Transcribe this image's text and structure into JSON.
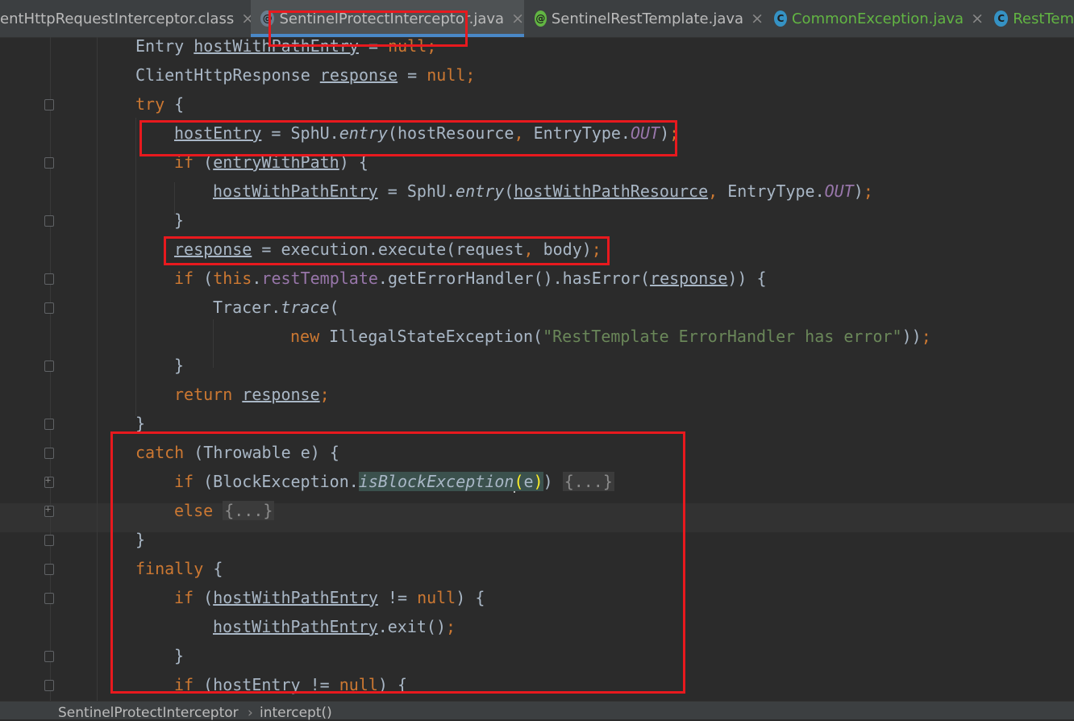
{
  "tabs": [
    {
      "label": "entHttpRequestInterceptor.class",
      "icon": "",
      "active": false
    },
    {
      "label": "SentinelProtectInterceptor.java",
      "icon": "annotation-class-icon",
      "active": true
    },
    {
      "label": "SentinelRestTemplate.java",
      "icon": "annotation-class-icon",
      "active": false
    },
    {
      "label": "CommonException.java",
      "icon": "class-icon",
      "active": false
    },
    {
      "label": "RestTem",
      "icon": "class-icon",
      "active": false
    }
  ],
  "close_glyph": "×",
  "icons": {
    "class": "C",
    "annotation": "@"
  },
  "code": {
    "l1": {
      "a": "Entry ",
      "b": "hostWithPathEntry",
      "c": " = ",
      "d": "null",
      "e": ";"
    },
    "l2": {
      "a": "ClientHttpResponse ",
      "b": "response",
      "c": " = ",
      "d": "null",
      "e": ";"
    },
    "l3": {
      "a": "try",
      "b": " {"
    },
    "l4": {
      "a": "hostEntry",
      "b": " = SphU.",
      "c": "entry",
      "d": "(hostResource",
      "e": ", ",
      "f": "EntryType.",
      "g": "OUT",
      "h": ")",
      "i": ";"
    },
    "l5": {
      "a": "if",
      "b": " (",
      "c": "entryWithPath",
      "d": ") {"
    },
    "l6": {
      "a": "hostWithPathEntry",
      "b": " = SphU.",
      "c": "entry",
      "d": "(",
      "e": "hostWithPathResource",
      "f": ", ",
      "g": "EntryType.",
      "h": "OUT",
      "i": ")",
      "j": ";"
    },
    "l7": {
      "a": "}"
    },
    "l8": {
      "a": "response",
      "b": " = execution.execute(request",
      "c": ", ",
      "d": "body)",
      "e": ";"
    },
    "l9": {
      "a": "if",
      "b": " (",
      "c": "this",
      "d": ".",
      "e": "restTemplate",
      "f": ".getErrorHandler().hasError(",
      "g": "response",
      "h": ")) {"
    },
    "l10": {
      "a": "Tracer.",
      "b": "trace",
      "c": "("
    },
    "l11": {
      "a": "new ",
      "b": "IllegalStateException(",
      "c": "\"RestTemplate ErrorHandler has error\"",
      "d": "))",
      "e": ";"
    },
    "l12": {
      "a": "}"
    },
    "l13": {
      "a": "return ",
      "b": "response",
      "c": ";"
    },
    "l14": {
      "a": "}"
    },
    "l15": {
      "a": "catch",
      "b": " (Throwable e) {"
    },
    "l16": {
      "a": "if",
      "b": " (BlockException.",
      "c": "isBlockException",
      "d": "(",
      "e": "e",
      "f": ")",
      "g": ") ",
      "h": "{...}"
    },
    "l17": {
      "a": "else ",
      "b": "{...}"
    },
    "l18": {
      "a": "}"
    },
    "l19": {
      "a": "finally",
      "b": " {"
    },
    "l20": {
      "a": "if",
      "b": " (",
      "c": "hostWithPathEntry",
      "d": " != ",
      "e": "null",
      "f": ") {"
    },
    "l21": {
      "a": "hostWithPathEntry",
      "b": ".exit()",
      "c": ";"
    },
    "l22": {
      "a": "}"
    },
    "l23": {
      "a": "if",
      "b": " (hostEntry != ",
      "c": "null",
      "d": ") {"
    }
  },
  "breadcrumb": {
    "class_name": "SentinelProtectInterceptor",
    "separator": "›",
    "method_name": "intercept()"
  },
  "colors": {
    "annotation_box": "#e8191e",
    "keyword": "#cc7832",
    "tab_underline": "#4a88c7"
  }
}
